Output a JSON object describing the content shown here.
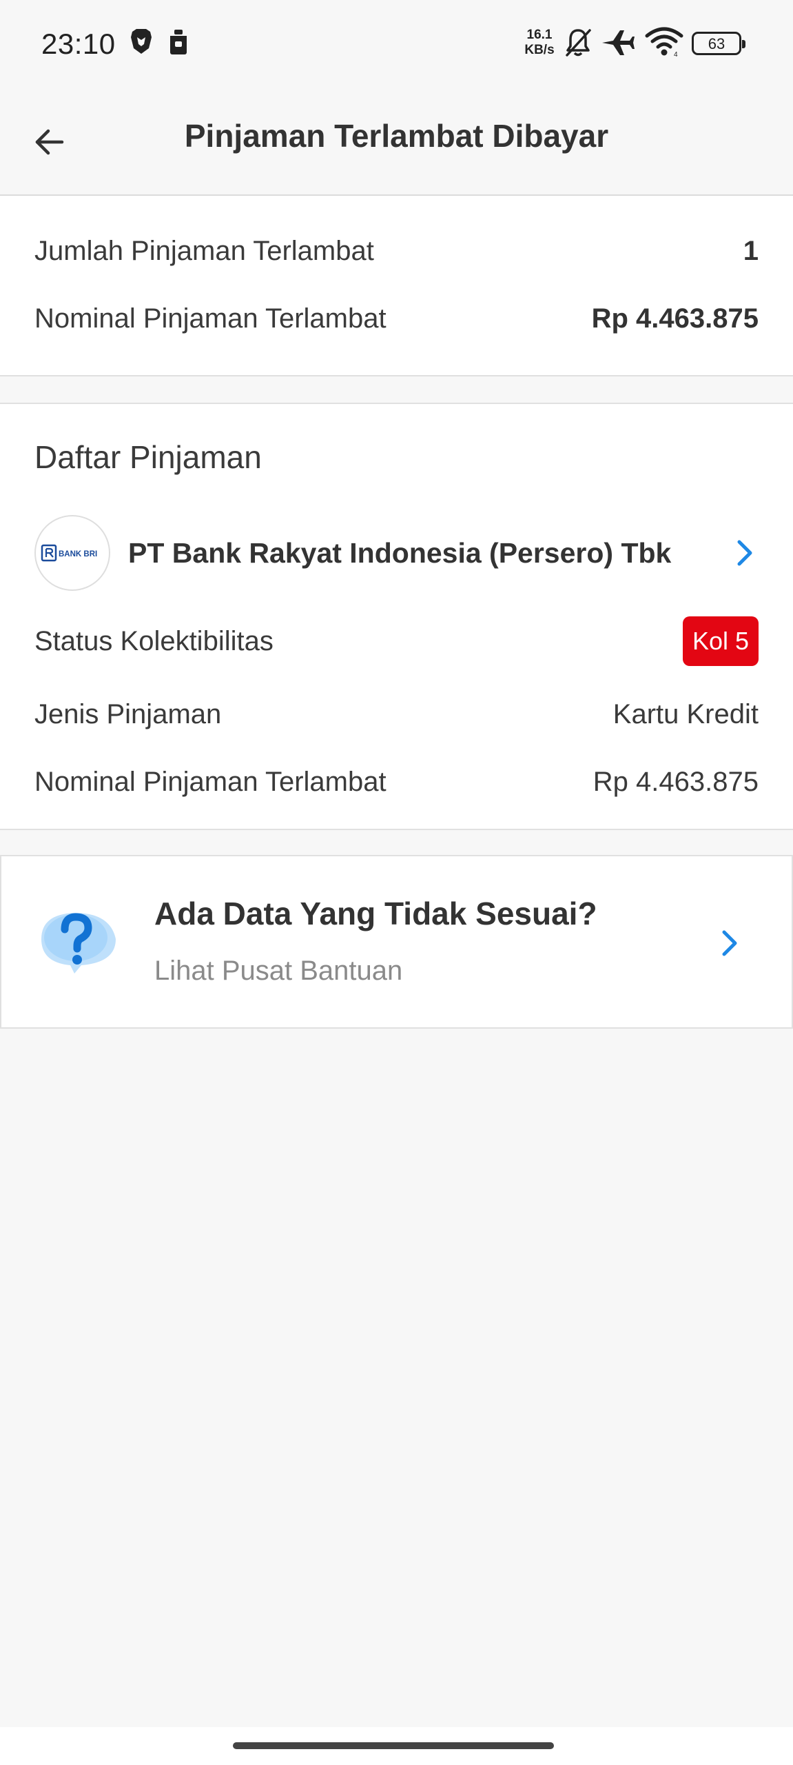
{
  "status_bar": {
    "time": "23:10",
    "net_speed_value": "16.1",
    "net_speed_unit": "KB/s",
    "battery": "63",
    "icons": [
      "brave-icon",
      "notification-bag-icon",
      "mute-bell-icon",
      "airplane-icon",
      "wifi-icon",
      "battery-icon"
    ]
  },
  "header": {
    "title": "Pinjaman Terlambat Dibayar",
    "back_icon": "arrow-left-icon"
  },
  "summary": {
    "count_label": "Jumlah Pinjaman Terlambat",
    "count_value": "1",
    "nominal_label": "Nominal Pinjaman Terlambat",
    "nominal_value": "Rp 4.463.875"
  },
  "loan_list": {
    "title": "Daftar Pinjaman",
    "items": [
      {
        "bank_name": "PT Bank Rakyat Indonesia (Persero) Tbk",
        "logo_text": "BANK BRI",
        "status_label": "Status Kolektibilitas",
        "status_value": "Kol 5",
        "type_label": "Jenis Pinjaman",
        "type_value": "Kartu Kredit",
        "nominal_label": "Nominal Pinjaman Terlambat",
        "nominal_value": "Rp 4.463.875"
      }
    ]
  },
  "help": {
    "title": "Ada Data Yang Tidak Sesuai?",
    "subtitle": "Lihat Pusat Bantuan",
    "icon": "question-bubble-icon"
  },
  "colors": {
    "accent": "#1e88e5",
    "badge_red": "#e30613",
    "background": "#f7f7f7"
  }
}
